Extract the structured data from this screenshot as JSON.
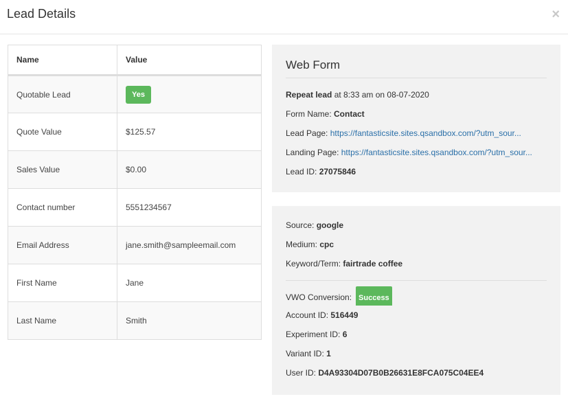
{
  "modal": {
    "title": "Lead Details",
    "close_glyph": "×"
  },
  "table": {
    "headers": {
      "name": "Name",
      "value": "Value"
    },
    "rows": [
      {
        "name": "Quotable Lead",
        "value": "Yes"
      },
      {
        "name": "Quote Value",
        "value": "$125.57"
      },
      {
        "name": "Sales Value",
        "value": "$0.00"
      },
      {
        "name": "Contact number",
        "value": "5551234567"
      },
      {
        "name": "Email Address",
        "value": "jane.smith@sampleemail.com"
      },
      {
        "name": "First Name",
        "value": "Jane"
      },
      {
        "name": "Last Name",
        "value": "Smith"
      }
    ],
    "badge_color": "#5cb85c"
  },
  "webform": {
    "title": "Web Form",
    "repeat_label": "Repeat lead",
    "repeat_time": " at 8:33 am on 08-07-2020",
    "form_name_label": "Form Name: ",
    "form_name": "Contact",
    "lead_page_label": "Lead Page: ",
    "lead_page_url": "https://fantasticsite.sites.qsandbox.com/?utm_sour...",
    "landing_page_label": "Landing Page: ",
    "landing_page_url": "https://fantasticsite.sites.qsandbox.com/?utm_sour...",
    "lead_id_label": "Lead ID: ",
    "lead_id": "27075846",
    "link_color": "#2a6fa8"
  },
  "source": {
    "source_label": "Source: ",
    "source": "google",
    "medium_label": "Medium: ",
    "medium": "cpc",
    "keyword_label": "Keyword/Term: ",
    "keyword": "fairtrade coffee",
    "vwo_label": "VWO Conversion:",
    "vwo_status": "Success",
    "account_label": "Account ID: ",
    "account_id": "516449",
    "experiment_label": "Experiment ID: ",
    "experiment_id": "6",
    "variant_label": "Variant ID: ",
    "variant_id": "1",
    "user_label": "User ID: ",
    "user_id": "D4A93304D07B0B26631E8FCA075C04EE4"
  }
}
